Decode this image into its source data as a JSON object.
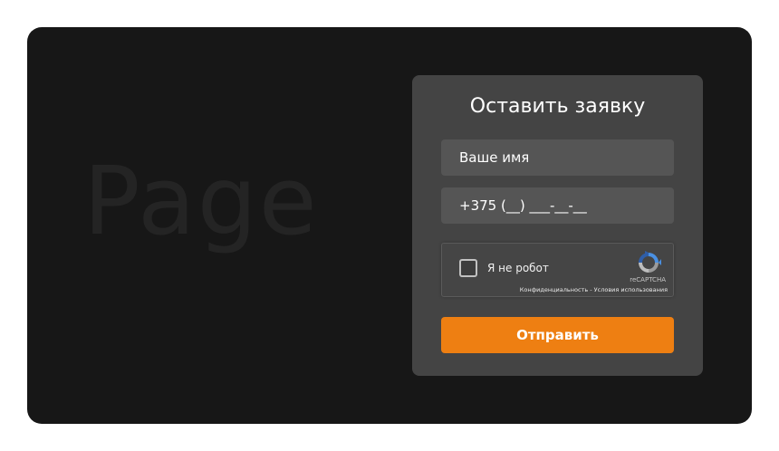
{
  "background": {
    "watermark_text": "Page"
  },
  "form": {
    "title": "Оставить заявку",
    "name_field": {
      "value": "",
      "placeholder": "Ваше имя"
    },
    "phone_field": {
      "value": "+375 (__) ___-__-__"
    },
    "recaptcha": {
      "checkbox_label": "Я не робот",
      "brand": "reCAPTCHA",
      "privacy_link": "Конфиденциальность",
      "separator": " - ",
      "terms_link": "Условия использования",
      "checked": false
    },
    "submit_label": "Отправить"
  },
  "colors": {
    "page_bg": "#ffffff",
    "frame_bg": "#171717",
    "card_bg": "#444444",
    "field_bg": "#555555",
    "accent": "#ee7f12"
  },
  "icons": {
    "recaptcha_logo": "recaptcha-logo-icon"
  }
}
